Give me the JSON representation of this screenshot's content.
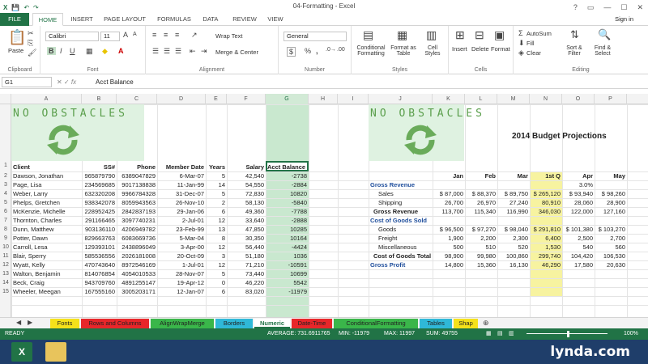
{
  "window": {
    "title": "04-Formatting - Excel",
    "signin": "Sign in",
    "controls": [
      "?",
      "▭",
      "—",
      "☐",
      "✕"
    ]
  },
  "ribbon_tabs": [
    "FILE",
    "HOME",
    "INSERT",
    "PAGE LAYOUT",
    "FORMULAS",
    "DATA",
    "REVIEW",
    "VIEW"
  ],
  "ribbon": {
    "clipboard": "Clipboard",
    "font_group": "Font",
    "alignment": "Alignment",
    "number_group": "Number",
    "styles": "Styles",
    "cells": "Cells",
    "editing": "Editing",
    "font_name": "Calibri",
    "font_size": "11",
    "wrap_text": "Wrap Text",
    "merge_center": "Merge & Center",
    "number_format": "General",
    "cond_fmt": "Conditional Formatting",
    "format_table": "Format as Table",
    "cell_styles": "Cell Styles",
    "insert": "Insert",
    "delete": "Delete",
    "format": "Format",
    "autosum": "AutoSum",
    "fill": "Fill",
    "clear": "Clear",
    "sort_filter": "Sort & Filter",
    "find_select": "Find & Select",
    "paste": "Paste",
    "bold": "B",
    "italic": "I",
    "underline": "U",
    "dollar": "$",
    "percent": "%",
    "comma": ","
  },
  "formula_bar": {
    "name_box": "G1",
    "fx": "fx",
    "content": "Acct Balance"
  },
  "columns": [
    "A",
    "B",
    "C",
    "D",
    "E",
    "F",
    "G",
    "H",
    "I",
    "J",
    "K",
    "L",
    "M",
    "N",
    "O",
    "P"
  ],
  "rows": [
    "1",
    "2",
    "3",
    "4",
    "5",
    "6",
    "7",
    "8",
    "9",
    "10",
    "11",
    "12",
    "13",
    "14",
    "15"
  ],
  "left": {
    "banner": "NO OBSTACLES",
    "headers": [
      "Client",
      "SS#",
      "Phone",
      "Member Date",
      "Years",
      "Salary",
      "Acct Balance"
    ],
    "data": [
      [
        "Dawson, Jonathan",
        "965879790",
        "6389047829",
        "6-Mar-07",
        "5",
        "42,540",
        "-2738"
      ],
      [
        "Page, Lisa",
        "234569685",
        "9017138838",
        "11-Jan-99",
        "14",
        "54,550",
        "-2884"
      ],
      [
        "Weber, Larry",
        "632320208",
        "9966784328",
        "31-Dec-07",
        "5",
        "72,830",
        "10820"
      ],
      [
        "Phelps, Gretchen",
        "938342078",
        "8059943563",
        "26-Nov-10",
        "2",
        "58,130",
        "-5840"
      ],
      [
        "McKenzie, Michelle",
        "228952425",
        "2842837193",
        "29-Jan-06",
        "6",
        "49,360",
        "-7788"
      ],
      [
        "Thornton, Charles",
        "291166465",
        "3097740231",
        "2-Jul-01",
        "12",
        "33,640",
        "-2888"
      ],
      [
        "Dunn, Matthew",
        "903136110",
        "4206949782",
        "23-Feb-99",
        "13",
        "47,850",
        "10285"
      ],
      [
        "Potter, Dawn",
        "829663763",
        "6083669736",
        "5-Mar-04",
        "8",
        "30,350",
        "10164"
      ],
      [
        "Carroll, Lesa",
        "129393101",
        "2438896049",
        "3-Apr-00",
        "12",
        "56,440",
        "-4424"
      ],
      [
        "Blair, Sperry",
        "585536556",
        "2026181008",
        "20-Oct-09",
        "3",
        "51,180",
        "1036"
      ],
      [
        "Wyatt, Kelly",
        "470743640",
        "8972546169",
        "1-Jul-01",
        "12",
        "71,210",
        "-10591"
      ],
      [
        "Walton, Benjamin",
        "814076854",
        "4054010533",
        "28-Nov-07",
        "5",
        "73,440",
        "10699"
      ],
      [
        "Beck, Craig",
        "943709760",
        "4891255147",
        "19-Apr-12",
        "0",
        "46,220",
        "5542"
      ],
      [
        "Wheeler, Meegan",
        "167555160",
        "3005203171",
        "12-Jan-07",
        "6",
        "83,020",
        "-11979"
      ]
    ]
  },
  "right": {
    "banner": "NO OBSTACLES",
    "title": "2014 Budget Projections",
    "months": [
      "Jan",
      "Feb",
      "Mar",
      "1st Q",
      "Apr",
      "May"
    ],
    "growth": "3.0%",
    "gross_revenue": "Gross Revenue",
    "cogs": "Cost of Goods Sold",
    "gross_profit": "Gross Profit",
    "rows": [
      {
        "label": "Sales",
        "vals": [
          "$ 87,000",
          "$ 88,370",
          "$ 89,750",
          "$ 265,120",
          "$ 93,940",
          "$ 98,260"
        ]
      },
      {
        "label": "Shipping",
        "vals": [
          "26,700",
          "26,970",
          "27,240",
          "80,910",
          "28,060",
          "28,900"
        ]
      },
      {
        "label": "Gross Revenue",
        "vals": [
          "113,700",
          "115,340",
          "116,990",
          "346,030",
          "122,000",
          "127,160"
        ]
      },
      {
        "label": "Goods",
        "vals": [
          "$ 96,500",
          "$ 97,270",
          "$ 98,040",
          "$ 291,810",
          "$ 101,380",
          "$ 103,270"
        ]
      },
      {
        "label": "Freight",
        "vals": [
          "1,900",
          "2,200",
          "2,300",
          "6,400",
          "2,500",
          "2,700"
        ]
      },
      {
        "label": "Miscellaneous",
        "vals": [
          "500",
          "510",
          "520",
          "1,530",
          "540",
          "560"
        ]
      },
      {
        "label": "Cost of Goods Total",
        "vals": [
          "98,900",
          "99,980",
          "100,860",
          "299,740",
          "104,420",
          "106,530"
        ]
      },
      {
        "label": "Gross Profit",
        "vals": [
          "14,800",
          "15,360",
          "16,130",
          "46,290",
          "17,580",
          "20,630"
        ]
      }
    ]
  },
  "sheet_tabs": [
    {
      "name": "Fonts",
      "color": "#f5e11a"
    },
    {
      "name": "Rows and Columns",
      "color": "#e8262a"
    },
    {
      "name": "AlignWrapMerge",
      "color": "#3ab64a"
    },
    {
      "name": "Borders",
      "color": "#2fb8d8"
    },
    {
      "name": "Numeric",
      "color": "#ffffff"
    },
    {
      "name": "Date-Time",
      "color": "#e8262a"
    },
    {
      "name": "ConditionalFormatting",
      "color": "#3ab64a"
    },
    {
      "name": "Tables",
      "color": "#2fb8d8"
    },
    {
      "name": "Shap",
      "color": "#f5e11a"
    }
  ],
  "status": {
    "ready": "READY",
    "average": "AVERAGE: 731.6911765",
    "min": "MIN: -11979",
    "max": "MAX: 11997",
    "sum": "SUM: 49755",
    "zoom": "100%"
  },
  "taskbar": {
    "brand": "lynda.com"
  },
  "colors": {
    "excel_green": "#217346",
    "selected_col": "#c9e8cf",
    "banner": "#dff2e1",
    "highlight": "#f7f3a0",
    "blue_label": "#1f4e9c"
  }
}
